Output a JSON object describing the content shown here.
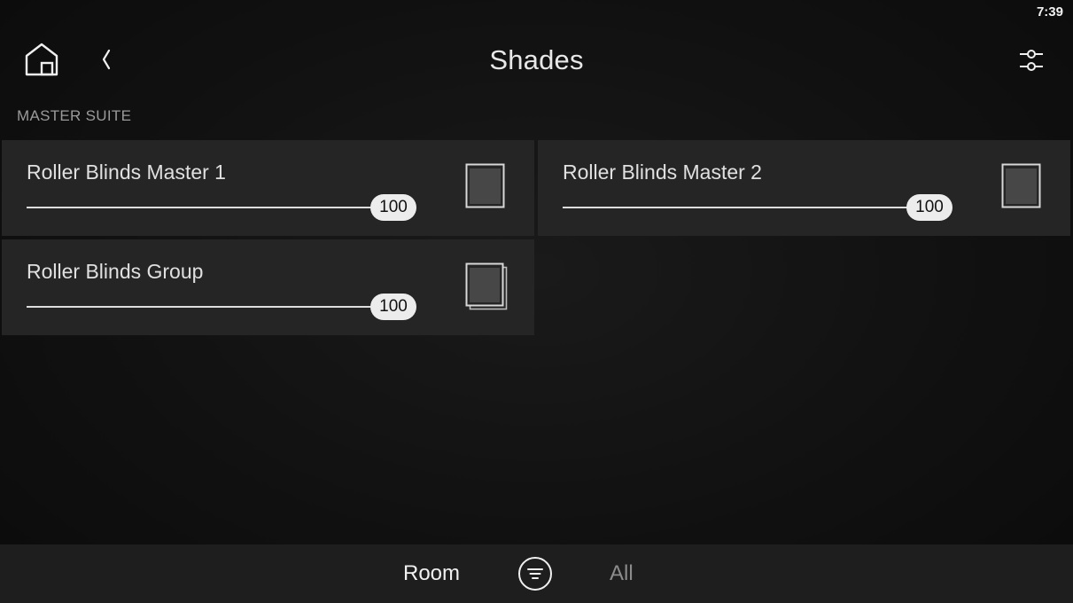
{
  "status": {
    "time": "7:39"
  },
  "header": {
    "title": "Shades",
    "home_icon": "home-icon",
    "back_icon": "chevron-left-icon",
    "settings_icon": "sliders-icon"
  },
  "section": {
    "label": "MASTER SUITE"
  },
  "shades": [
    {
      "name": "Roller Blinds Master 1",
      "value": "100",
      "icon": "shade-icon"
    },
    {
      "name": "Roller Blinds Master 2",
      "value": "100",
      "icon": "shade-icon"
    },
    {
      "name": "Roller Blinds Group",
      "value": "100",
      "icon": "shade-group-icon"
    }
  ],
  "footer": {
    "tabs": [
      {
        "label": "Room",
        "active": true
      },
      {
        "label": "All",
        "active": false
      }
    ],
    "filter_icon": "filter-icon"
  },
  "colors": {
    "background": "#111111",
    "card": "#252525",
    "bottom_bar": "#1e1e1e",
    "accent_text": "#e8e8e8",
    "muted_text": "#9a9a9a"
  }
}
